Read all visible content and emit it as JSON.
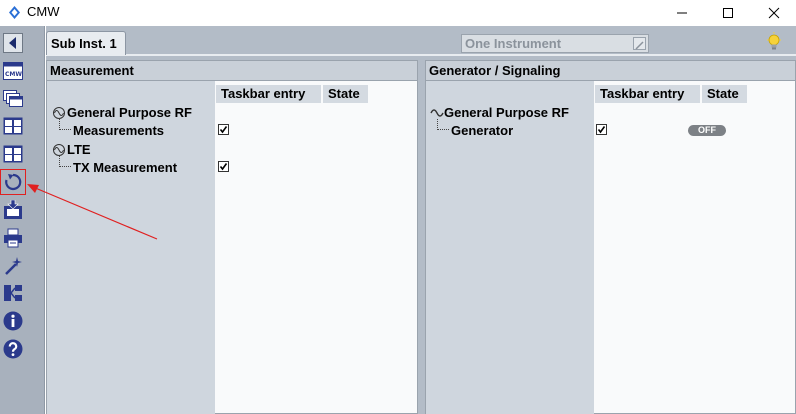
{
  "window": {
    "title": "CMW",
    "logo_icon": "rs-logo-icon",
    "controls": [
      "minimize-icon",
      "maximize-icon",
      "close-icon"
    ]
  },
  "toolbar": {
    "icons": [
      "back-arrow-icon",
      "cmw-instrument-icon",
      "windows-stack-icon",
      "layout-grid-icon",
      "layout-grid-alt-icon",
      "reset-icon",
      "save-icon",
      "print-icon",
      "wizard-icon",
      "hierarchy-icon",
      "info-icon",
      "help-icon"
    ],
    "highlighted": "reset-icon"
  },
  "main": {
    "tab_label": "Sub Inst. 1",
    "instrument_select": "One Instrument",
    "status_icon": "lightbulb-icon"
  },
  "measurement_panel": {
    "title": "Measurement",
    "columns": [
      "Taskbar entry",
      "State"
    ],
    "groups": [
      {
        "label": "General Purpose RF",
        "item": "Measurements",
        "checked": true
      },
      {
        "label": "LTE",
        "item": "TX Measurement",
        "checked": true
      }
    ]
  },
  "generator_panel": {
    "title": "Generator / Signaling",
    "columns": [
      "Taskbar entry",
      "State"
    ],
    "groups": [
      {
        "label": "General Purpose RF",
        "item": "Generator",
        "checked": true,
        "state": "OFF"
      }
    ]
  },
  "colors": {
    "toolbar_bg": "#a8b1bd",
    "panel_bg": "#f9fafb",
    "annotation": "#e02020",
    "icon_blue": "#2b3a8c"
  }
}
